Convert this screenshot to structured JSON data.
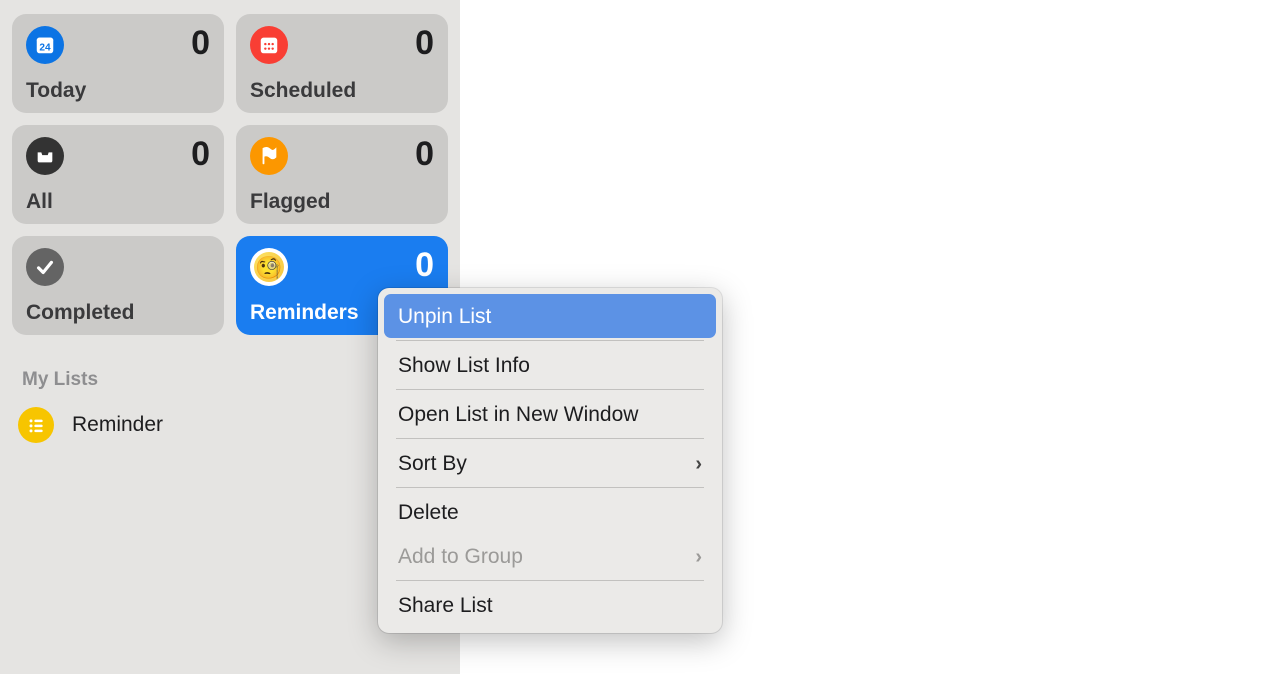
{
  "sidebar": {
    "smartLists": [
      {
        "key": "today",
        "label": "Today",
        "count": 0,
        "iconColor": "#0c74e4",
        "icon": "calendar-today-icon"
      },
      {
        "key": "scheduled",
        "label": "Scheduled",
        "count": 0,
        "iconColor": "#f93e34",
        "icon": "calendar-icon"
      },
      {
        "key": "all",
        "label": "All",
        "count": 0,
        "iconColor": "#333333",
        "icon": "tray-icon"
      },
      {
        "key": "flagged",
        "label": "Flagged",
        "count": 0,
        "iconColor": "#fc9700",
        "icon": "flag-icon"
      },
      {
        "key": "completed",
        "label": "Completed",
        "count": null,
        "iconColor": "#646464",
        "icon": "checkmark-icon"
      },
      {
        "key": "reminders",
        "label": "Reminders",
        "count": 0,
        "iconColor": "#ffffff",
        "icon": "emoji-icon",
        "selected": true
      }
    ],
    "myListsHeader": "My Lists",
    "lists": [
      {
        "key": "reminder",
        "label": "Reminder",
        "iconColor": "#f7c500",
        "icon": "list-bullet-icon"
      }
    ]
  },
  "contextMenu": {
    "items": [
      {
        "label": "Unpin List",
        "highlighted": true
      },
      {
        "separator": true
      },
      {
        "label": "Show List Info"
      },
      {
        "separator": true
      },
      {
        "label": "Open List in New Window"
      },
      {
        "separator": true
      },
      {
        "label": "Sort By",
        "submenu": true
      },
      {
        "separator": true
      },
      {
        "label": "Delete"
      },
      {
        "label": "Add to Group",
        "disabled": true,
        "submenu": true
      },
      {
        "separator": true
      },
      {
        "label": "Share List"
      }
    ]
  }
}
